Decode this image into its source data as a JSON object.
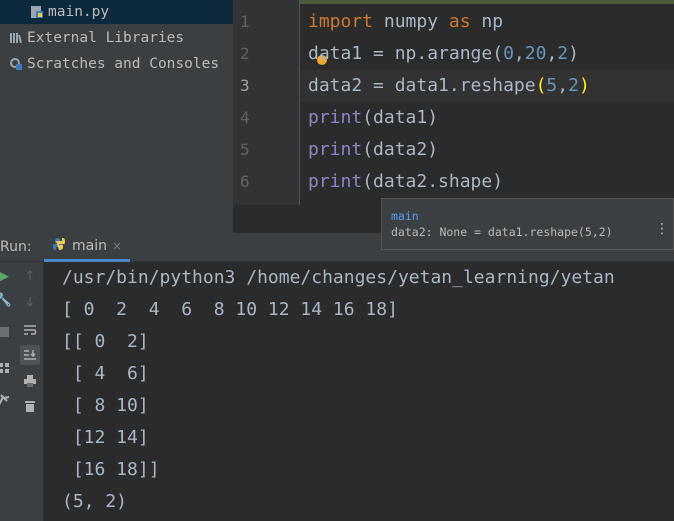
{
  "project_tree": {
    "items": [
      {
        "label": "main.py",
        "icon": "python-file-icon"
      },
      {
        "label": "External Libraries",
        "icon": "library-icon"
      },
      {
        "label": "Scratches and Consoles",
        "icon": "scratches-icon"
      }
    ]
  },
  "editor": {
    "line_numbers": [
      "1",
      "2",
      "3",
      "4",
      "5",
      "6"
    ],
    "lines": [
      {
        "kw1": "import",
        "t1": " numpy ",
        "kw2": "as",
        "t2": " np"
      },
      {
        "t1": "data1 = np.arange(",
        "n1": "0",
        "s1": ",",
        "n2": "20",
        "s2": ",",
        "n3": "2",
        "t2": ")"
      },
      {
        "t1": "data2 = data1.reshape",
        "p1": "(",
        "n1": "5",
        "s1": ",",
        "n2": "2",
        "p2": ")"
      },
      {
        "fn": "print",
        "t1": "(data1)"
      },
      {
        "fn": "print",
        "t1": "(data2)"
      },
      {
        "fn": "print",
        "t1": "(data2.shape)"
      }
    ]
  },
  "tooltip": {
    "title": "main",
    "text": "data2: None = data1.reshape(5,2)",
    "menu": "⋮"
  },
  "run_window": {
    "label": "Run:",
    "tab_label": "main",
    "tab_close": "×",
    "output_lines": [
      "/usr/bin/python3 /home/changes/yetan_learning/yetan",
      "[ 0  2  4  6  8 10 12 14 16 18]",
      "[[ 0  2]",
      " [ 4  6]",
      " [ 8 10]",
      " [12 14]",
      " [16 18]]",
      "(5, 2)"
    ]
  },
  "toolbar_icons": [
    "run-icon",
    "up-arrow-icon",
    "wrench-icon",
    "down-arrow-icon",
    "stop-icon",
    "soft-wrap-icon",
    "scroll-to-end-icon",
    "layout-icon",
    "print-icon",
    "pin-icon",
    "trash-icon"
  ]
}
